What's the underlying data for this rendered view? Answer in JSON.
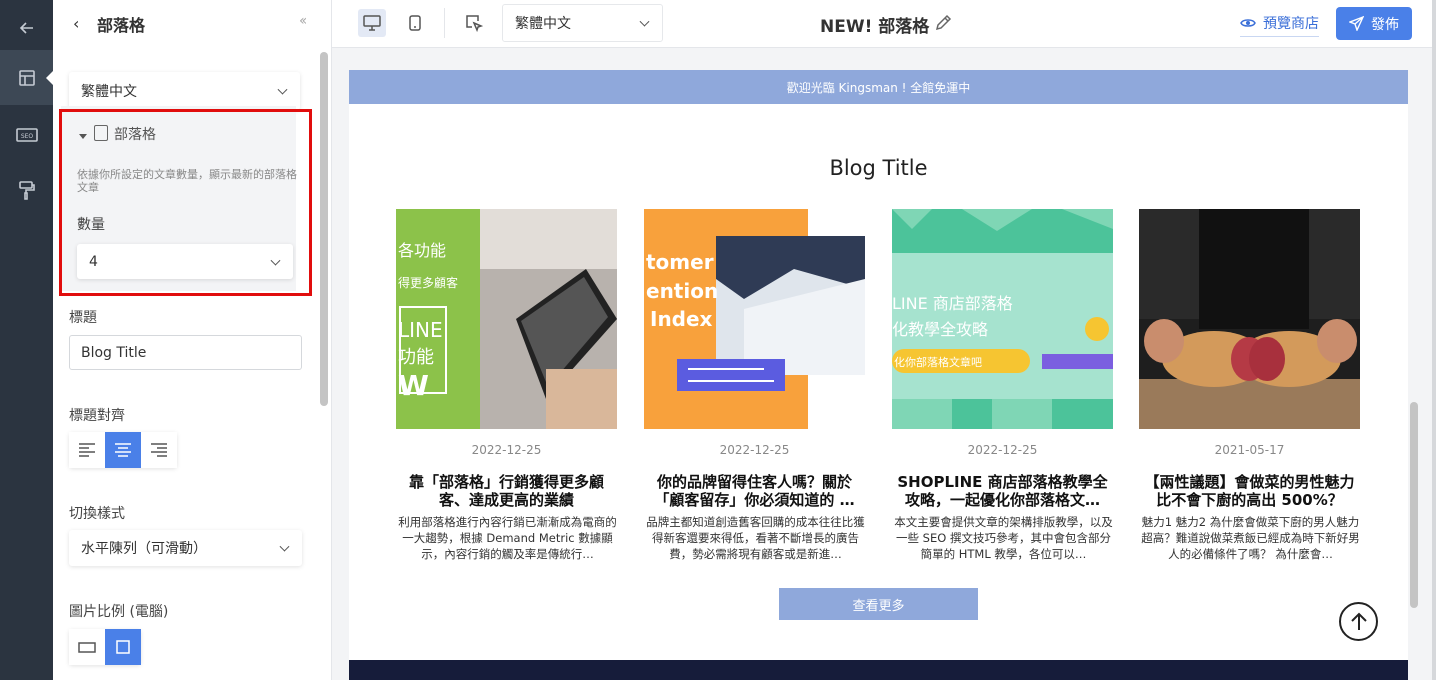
{
  "rail": {
    "items": [
      {
        "name": "back-arrow-icon"
      },
      {
        "name": "layout-icon",
        "active": true
      },
      {
        "name": "seo-icon",
        "text": "SEO"
      },
      {
        "name": "paint-roller-icon"
      }
    ]
  },
  "panel": {
    "title": "部落格",
    "language_value": "繁體中文",
    "blog_section": {
      "label": "部落格",
      "description": "依據你所設定的文章數量，顯示最新的部落格文章",
      "quantity_label": "數量",
      "quantity_value": "4"
    },
    "title_label": "標題",
    "title_value": "Blog Title",
    "alignment_label": "標題對齊",
    "alignment_selected": "center",
    "switch_style_label": "切換樣式",
    "switch_style_value": "水平陳列（可滑動）",
    "image_ratio_label": "圖片比例 (電腦)",
    "image_ratio_selected": "square"
  },
  "topbar": {
    "device_selected": "desktop",
    "language_value": "繁體中文",
    "page_name": "NEW! 部落格",
    "preview_label": "預覽商店",
    "publish_label": "發佈"
  },
  "canvas": {
    "announcement": "歡迎光臨 Kingsman ! 全館免運中",
    "blog_title": "Blog Title",
    "more_label": "查看更多",
    "posts": [
      {
        "date": "2022-12-25",
        "title": "靠「部落格」行銷獲得更多顧客、達成更高的業績",
        "excerpt": "利用部落格進行內容行銷已漸漸成為電商的一大趨勢，根據 Demand Metric 數據顯示，內容行銷的觸及率是傳統行…",
        "thumb_text": [
          "各功能",
          "得更多顧客",
          "LINE",
          "功能",
          "W"
        ]
      },
      {
        "date": "2022-12-25",
        "title": "你的品牌留得住客人嗎？關於「顧客留存」你必須知道的 …",
        "excerpt": "品牌主都知道創造舊客回購的成本往往比獲得新客還要來得低，看著不斷增長的廣告費，勢必需將現有顧客或是新進…",
        "thumb_text": [
          "tomer",
          "ention",
          "Index"
        ]
      },
      {
        "date": "2022-12-25",
        "title": "SHOPLINE 商店部落格教學全攻略，一起優化你部落格文…",
        "excerpt": "本文主要會提供文章的架構排版教學，以及一些 SEO 撰文技巧參考，其中會包含部分簡單的 HTML 教學，各位可以…",
        "thumb_text": [
          "LINE 商店部落格",
          "化教學全攻略",
          "化你部落格文章吧"
        ]
      },
      {
        "date": "2021-05-17",
        "title": "【兩性議題】會做菜的男性魅力比不會下廚的高出 500%？",
        "excerpt": "魅力1 魅力2 為什麼會做菜下廚的男人魅力超高？難道說做菜煮飯已經成為時下新好男人的必備條件了嗎？ 為什麼會…",
        "thumb_text": []
      }
    ]
  },
  "colors": {
    "accent": "#4a80e8",
    "banner": "#8fa8db",
    "highlight_outline": "#e10d0d",
    "rail": "#2b3440",
    "footer": "#161c3a"
  }
}
